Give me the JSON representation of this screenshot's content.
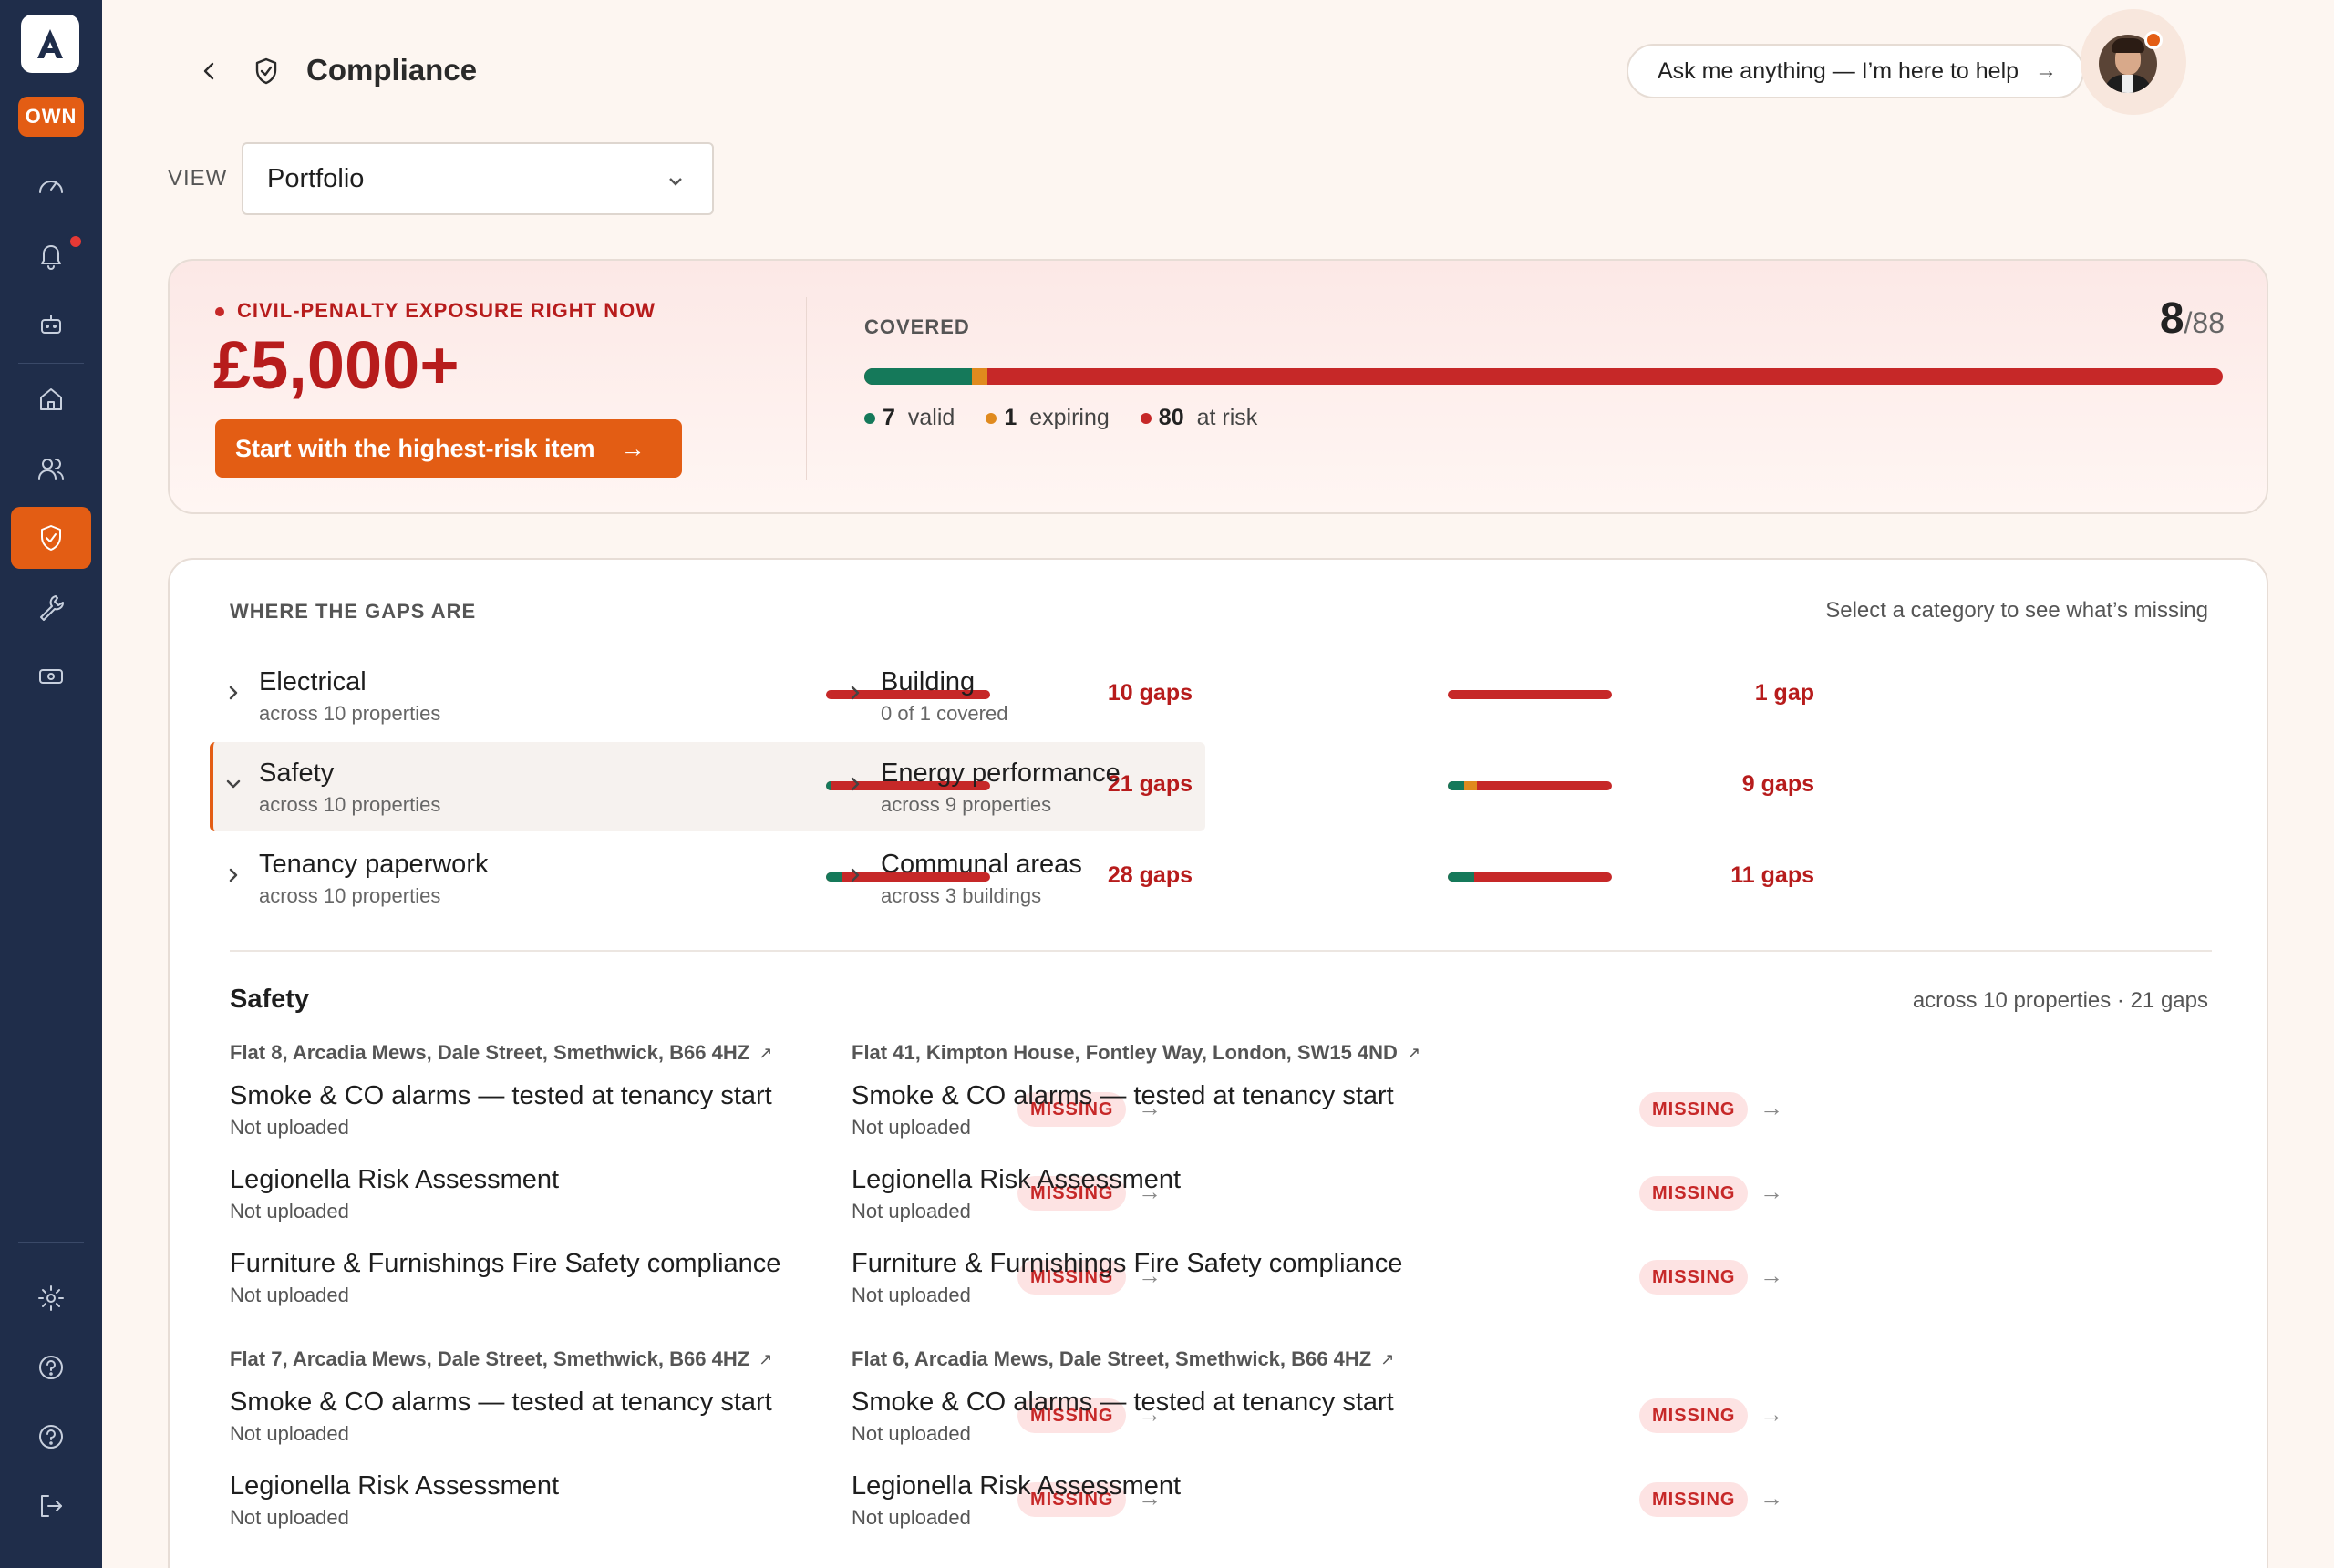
{
  "app": {
    "badge": "OWN"
  },
  "header": {
    "title": "Compliance",
    "ask_placeholder": "Ask me anything — I’m here to help",
    "ask_arrow": "→"
  },
  "view": {
    "label": "VIEW",
    "selected": "Portfolio"
  },
  "penalty": {
    "label": "CIVIL-PENALTY EXPOSURE RIGHT NOW",
    "amount": "£5,000+",
    "cta": "Start with the highest-risk item",
    "cta_arrow": "→"
  },
  "coverage": {
    "label": "COVERED",
    "covered": "8",
    "total": "/88",
    "valid_count": "7",
    "valid_label": "valid",
    "expiring_count": "1",
    "expiring_label": "expiring",
    "at_risk_count": "80",
    "at_risk_label": "at risk",
    "colors": {
      "valid": "#15795a",
      "expiring": "#e08a1e",
      "at_risk": "#c62828"
    },
    "fractions": {
      "valid": 0.0795,
      "expiring": 0.0114,
      "at_risk": 0.9091
    }
  },
  "gaps": {
    "heading": "WHERE THE GAPS ARE",
    "hint": "Select a category to see what’s missing",
    "categories": [
      {
        "name": "Electrical",
        "sub": "across 10 properties",
        "count": "10 gaps",
        "valid_frac": 0.0,
        "expiring_frac": 0.0
      },
      {
        "name": "Building",
        "sub": "0 of 1 covered",
        "count": "1 gap",
        "valid_frac": 0.0,
        "expiring_frac": 0.0
      },
      {
        "name": "Safety",
        "sub": "across 10 properties",
        "count": "21 gaps",
        "valid_frac": 0.03,
        "expiring_frac": 0.0
      },
      {
        "name": "Energy performance",
        "sub": "across 9 properties",
        "count": "9 gaps",
        "valid_frac": 0.1,
        "expiring_frac": 0.08
      },
      {
        "name": "Tenancy paperwork",
        "sub": "across 10 properties",
        "count": "28 gaps",
        "valid_frac": 0.1,
        "expiring_frac": 0.0
      },
      {
        "name": "Communal areas",
        "sub": "across 3 buildings",
        "count": "11 gaps",
        "valid_frac": 0.16,
        "expiring_frac": 0.0
      }
    ]
  },
  "detail": {
    "title": "Safety",
    "meta": "across 10 properties · 21 gaps",
    "properties": [
      {
        "address": "Flat 8, Arcadia Mews, Dale Street, Smethwick, B66 4HZ",
        "items": [
          {
            "name": "Smoke & CO alarms — tested at tenancy start",
            "status": "Not uploaded",
            "badge": "MISSING"
          },
          {
            "name": "Legionella Risk Assessment",
            "status": "Not uploaded",
            "badge": "MISSING"
          },
          {
            "name": "Furniture & Furnishings Fire Safety compliance",
            "status": "Not uploaded",
            "badge": "MISSING"
          }
        ]
      },
      {
        "address": "Flat 41, Kimpton House, Fontley Way, London, SW15 4ND",
        "items": [
          {
            "name": "Smoke & CO alarms — tested at tenancy start",
            "status": "Not uploaded",
            "badge": "MISSING"
          },
          {
            "name": "Legionella Risk Assessment",
            "status": "Not uploaded",
            "badge": "MISSING"
          },
          {
            "name": "Furniture & Furnishings Fire Safety compliance",
            "status": "Not uploaded",
            "badge": "MISSING"
          }
        ]
      },
      {
        "address": "Flat 7, Arcadia Mews, Dale Street, Smethwick, B66 4HZ",
        "items": [
          {
            "name": "Smoke & CO alarms — tested at tenancy start",
            "status": "Not uploaded",
            "badge": "MISSING"
          },
          {
            "name": "Legionella Risk Assessment",
            "status": "Not uploaded",
            "badge": "MISSING"
          }
        ]
      },
      {
        "address": "Flat 6, Arcadia Mews, Dale Street, Smethwick, B66 4HZ",
        "items": [
          {
            "name": "Smoke & CO alarms — tested at tenancy start",
            "status": "Not uploaded",
            "badge": "MISSING"
          },
          {
            "name": "Legionella Risk Assessment",
            "status": "Not uploaded",
            "badge": "MISSING"
          }
        ]
      }
    ]
  }
}
